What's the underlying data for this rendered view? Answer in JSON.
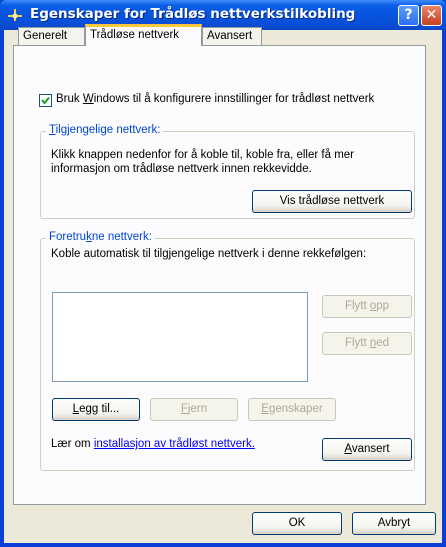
{
  "window": {
    "title": "Egenskaper for Trådløs nettverkstilkobling",
    "help_glyph": "?",
    "close_glyph": "✕",
    "icon": "network-connection-icon"
  },
  "tabs": [
    {
      "label": "Generelt",
      "active": false
    },
    {
      "label": "Trådløse nettverk",
      "active": true
    },
    {
      "label": "Avansert",
      "active": false
    }
  ],
  "use_windows_checkbox": {
    "checked": true,
    "label_before": "Bruk ",
    "label_accel": "W",
    "label_after": "indows til å konfigurere innstillinger for trådløst nettverk"
  },
  "available_networks": {
    "legend_accel": "T",
    "legend_rest": "ilgjengelige nettverk:",
    "description_line1": "Klikk knappen nedenfor for å koble til, koble fra, eller få mer",
    "description_line2": "informasjon om trådløse nettverk innen rekkevidde.",
    "view_button": "Vis trådløse nettverk"
  },
  "preferred_networks": {
    "legend_before": "Foretru",
    "legend_accel": "k",
    "legend_after": "ne nettverk:",
    "description": "Koble automatisk til tilgjengelige nettverk i denne rekkefølgen:",
    "items": [],
    "move_up_before": "Flytt ",
    "move_up_accel": "o",
    "move_up_after": "pp",
    "move_down_before": "Flytt ",
    "move_down_accel": "n",
    "move_down_after": "ed",
    "add_accel": "L",
    "add_rest": "egg til...",
    "remove_accel": "F",
    "remove_rest": "jern",
    "properties_accel": "E",
    "properties_rest": "genskaper"
  },
  "learn_about": {
    "prefix": "Lær om ",
    "link": "installasjon av trådløst nettverk."
  },
  "advanced_button": {
    "accel": "A",
    "rest": "vansert"
  },
  "footer": {
    "ok": "OK",
    "cancel": "Avbryt"
  }
}
